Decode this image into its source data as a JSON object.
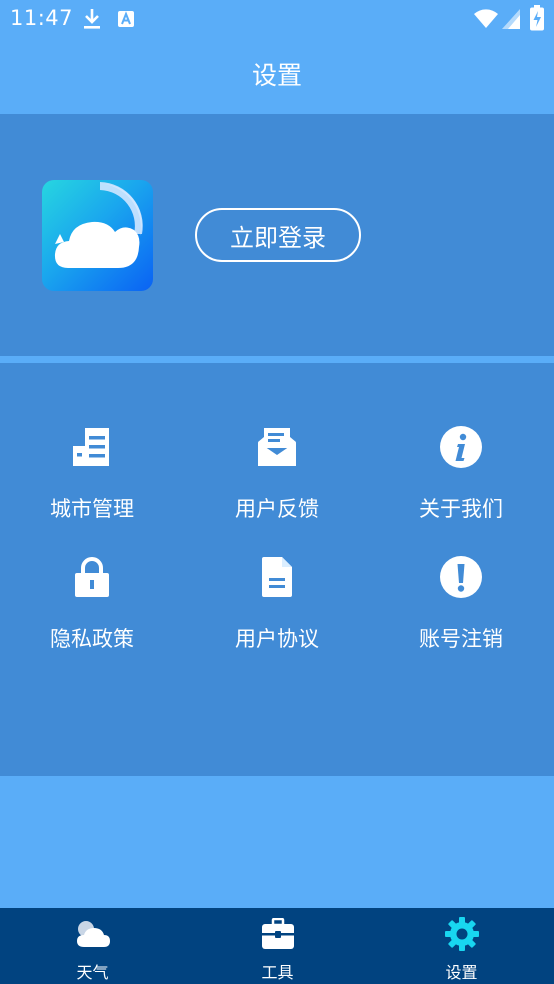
{
  "status_bar": {
    "time": "11:47"
  },
  "header": {
    "title": "设置"
  },
  "profile": {
    "login_label": "立即登录"
  },
  "menu": {
    "items": [
      {
        "label": "城市管理",
        "icon": "city-list-icon"
      },
      {
        "label": "用户反馈",
        "icon": "feedback-mail-icon"
      },
      {
        "label": "关于我们",
        "icon": "info-icon"
      },
      {
        "label": "隐私政策",
        "icon": "lock-icon"
      },
      {
        "label": "用户协议",
        "icon": "document-icon"
      },
      {
        "label": "账号注销",
        "icon": "exclamation-icon"
      }
    ]
  },
  "bottom_nav": {
    "items": [
      {
        "label": "天气",
        "icon": "weather-cloud-icon",
        "active": false
      },
      {
        "label": "工具",
        "icon": "toolbox-icon",
        "active": false
      },
      {
        "label": "设置",
        "icon": "gear-icon",
        "active": true
      }
    ]
  },
  "colors": {
    "page_background": "#5aadf8",
    "panel_background": "#418bd6",
    "nav_background": "#014380",
    "active_icon": "#18d6f0"
  }
}
